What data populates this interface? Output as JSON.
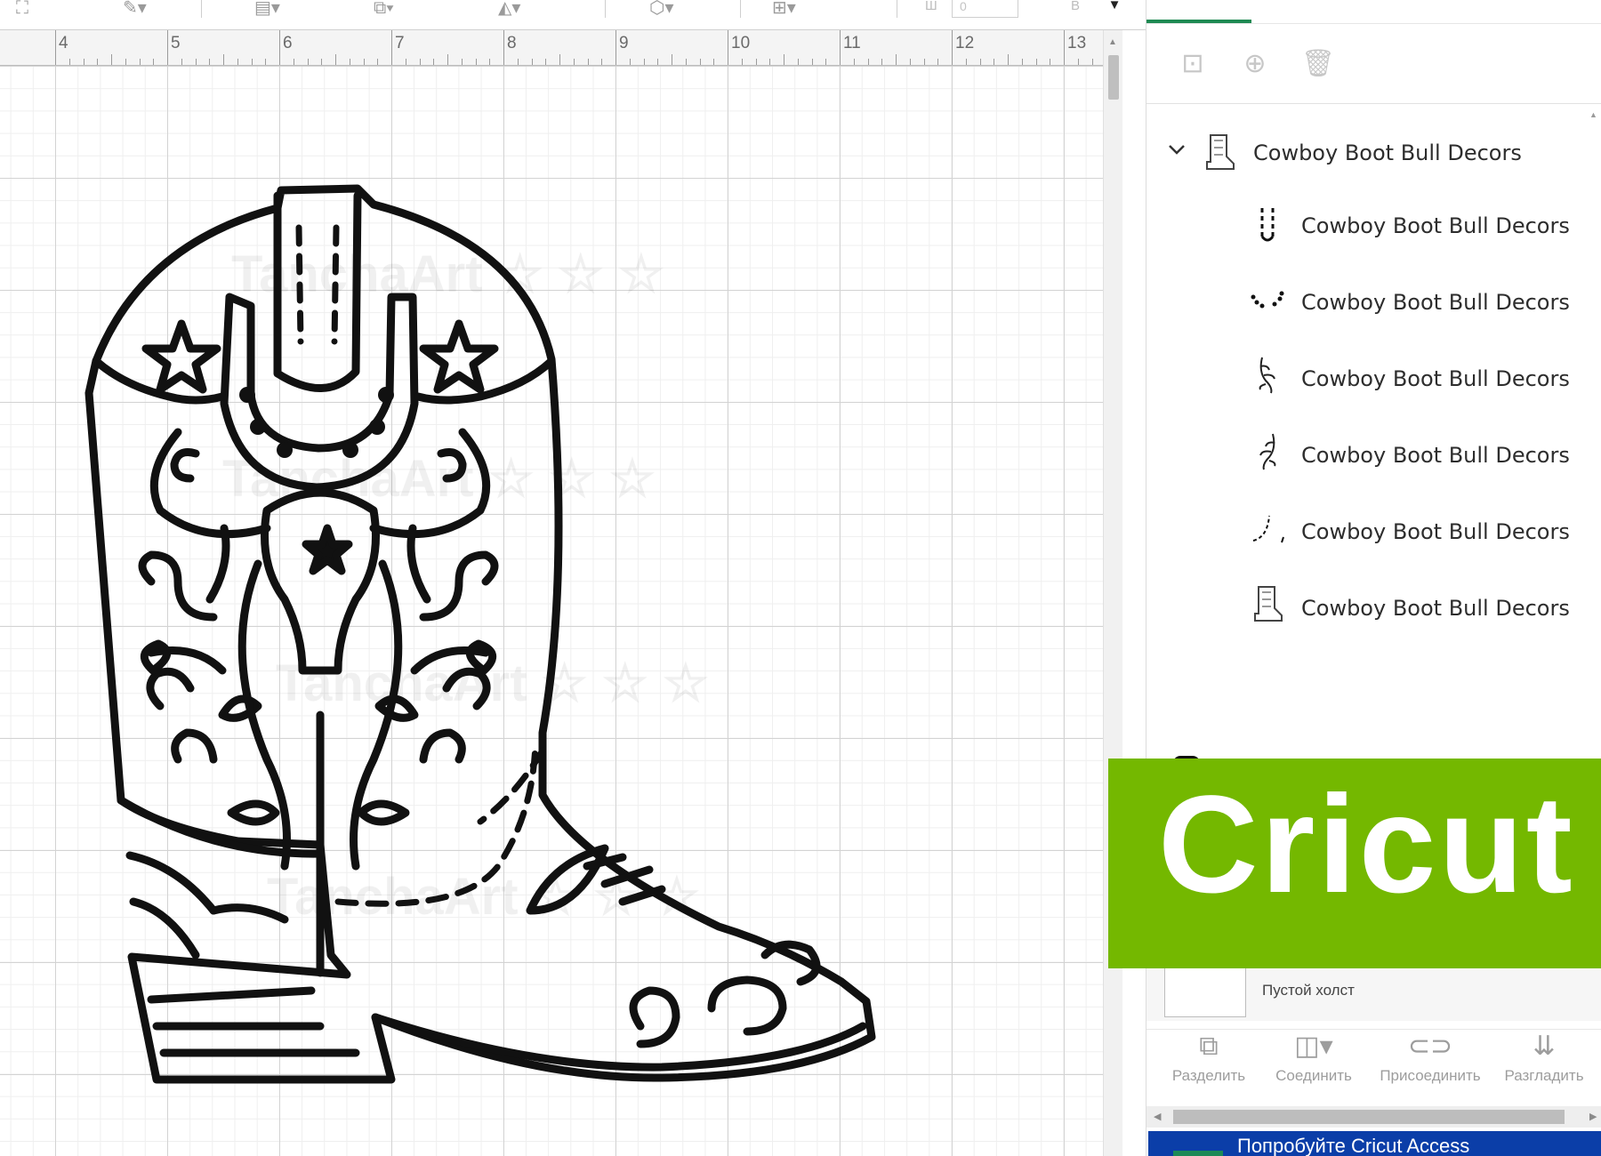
{
  "toolbar": {
    "field_w_label": "Ш",
    "field_w_value": "0",
    "field_h_label": "В",
    "field_h_value": "0",
    "icons": [
      "select-icon",
      "edit-pen-icon",
      "align-icon",
      "arrange-icon",
      "flip-icon",
      "offset-icon",
      "warp-icon",
      "more-caret-icon"
    ]
  },
  "ruler": {
    "numbers": [
      "4",
      "5",
      "6",
      "7",
      "8",
      "9",
      "10",
      "11",
      "12",
      "13"
    ]
  },
  "canvas": {
    "watermark_text": "TanchaArt ☆ ☆ ☆"
  },
  "panel": {
    "actions": [
      "group-icon",
      "duplicate-icon",
      "delete-icon"
    ],
    "layers": {
      "group": {
        "label": "Cowboy Boot Bull Decors",
        "thumb_icon": "cowboy-boot-thumb-icon",
        "expanded": true
      },
      "children": [
        {
          "label": "Cowboy Boot Bull Decors",
          "thumb_icon": "stitch-lines-thumb-icon"
        },
        {
          "label": "Cowboy Boot Bull Decors",
          "thumb_icon": "dots-thumb-icon"
        },
        {
          "label": "Cowboy Boot Bull Decors",
          "thumb_icon": "vine-left-thumb-icon"
        },
        {
          "label": "Cowboy Boot Bull Decors",
          "thumb_icon": "vine-right-thumb-icon"
        },
        {
          "label": "Cowboy Boot Bull Decors",
          "thumb_icon": "dashed-curve-thumb-icon"
        },
        {
          "label": "Cowboy Boot Bull Decors",
          "thumb_icon": "cowboy-boot-thumb-icon"
        }
      ]
    },
    "brand": {
      "text": "Cricut",
      "color": "#74b800"
    },
    "blank_canvas_label": "Пустой холст",
    "bottom_tools": [
      {
        "label": "Разделить",
        "icon": "slice-icon"
      },
      {
        "label": "Соединить",
        "icon": "combine-icon"
      },
      {
        "label": "Присоединить",
        "icon": "attach-icon"
      },
      {
        "label": "Разгладить",
        "icon": "flatten-icon"
      }
    ],
    "promo_text": "Попробуйте Cricut Access"
  },
  "colors": {
    "accent_green": "#1f8a53",
    "promo_blue": "#0b3ea8"
  }
}
